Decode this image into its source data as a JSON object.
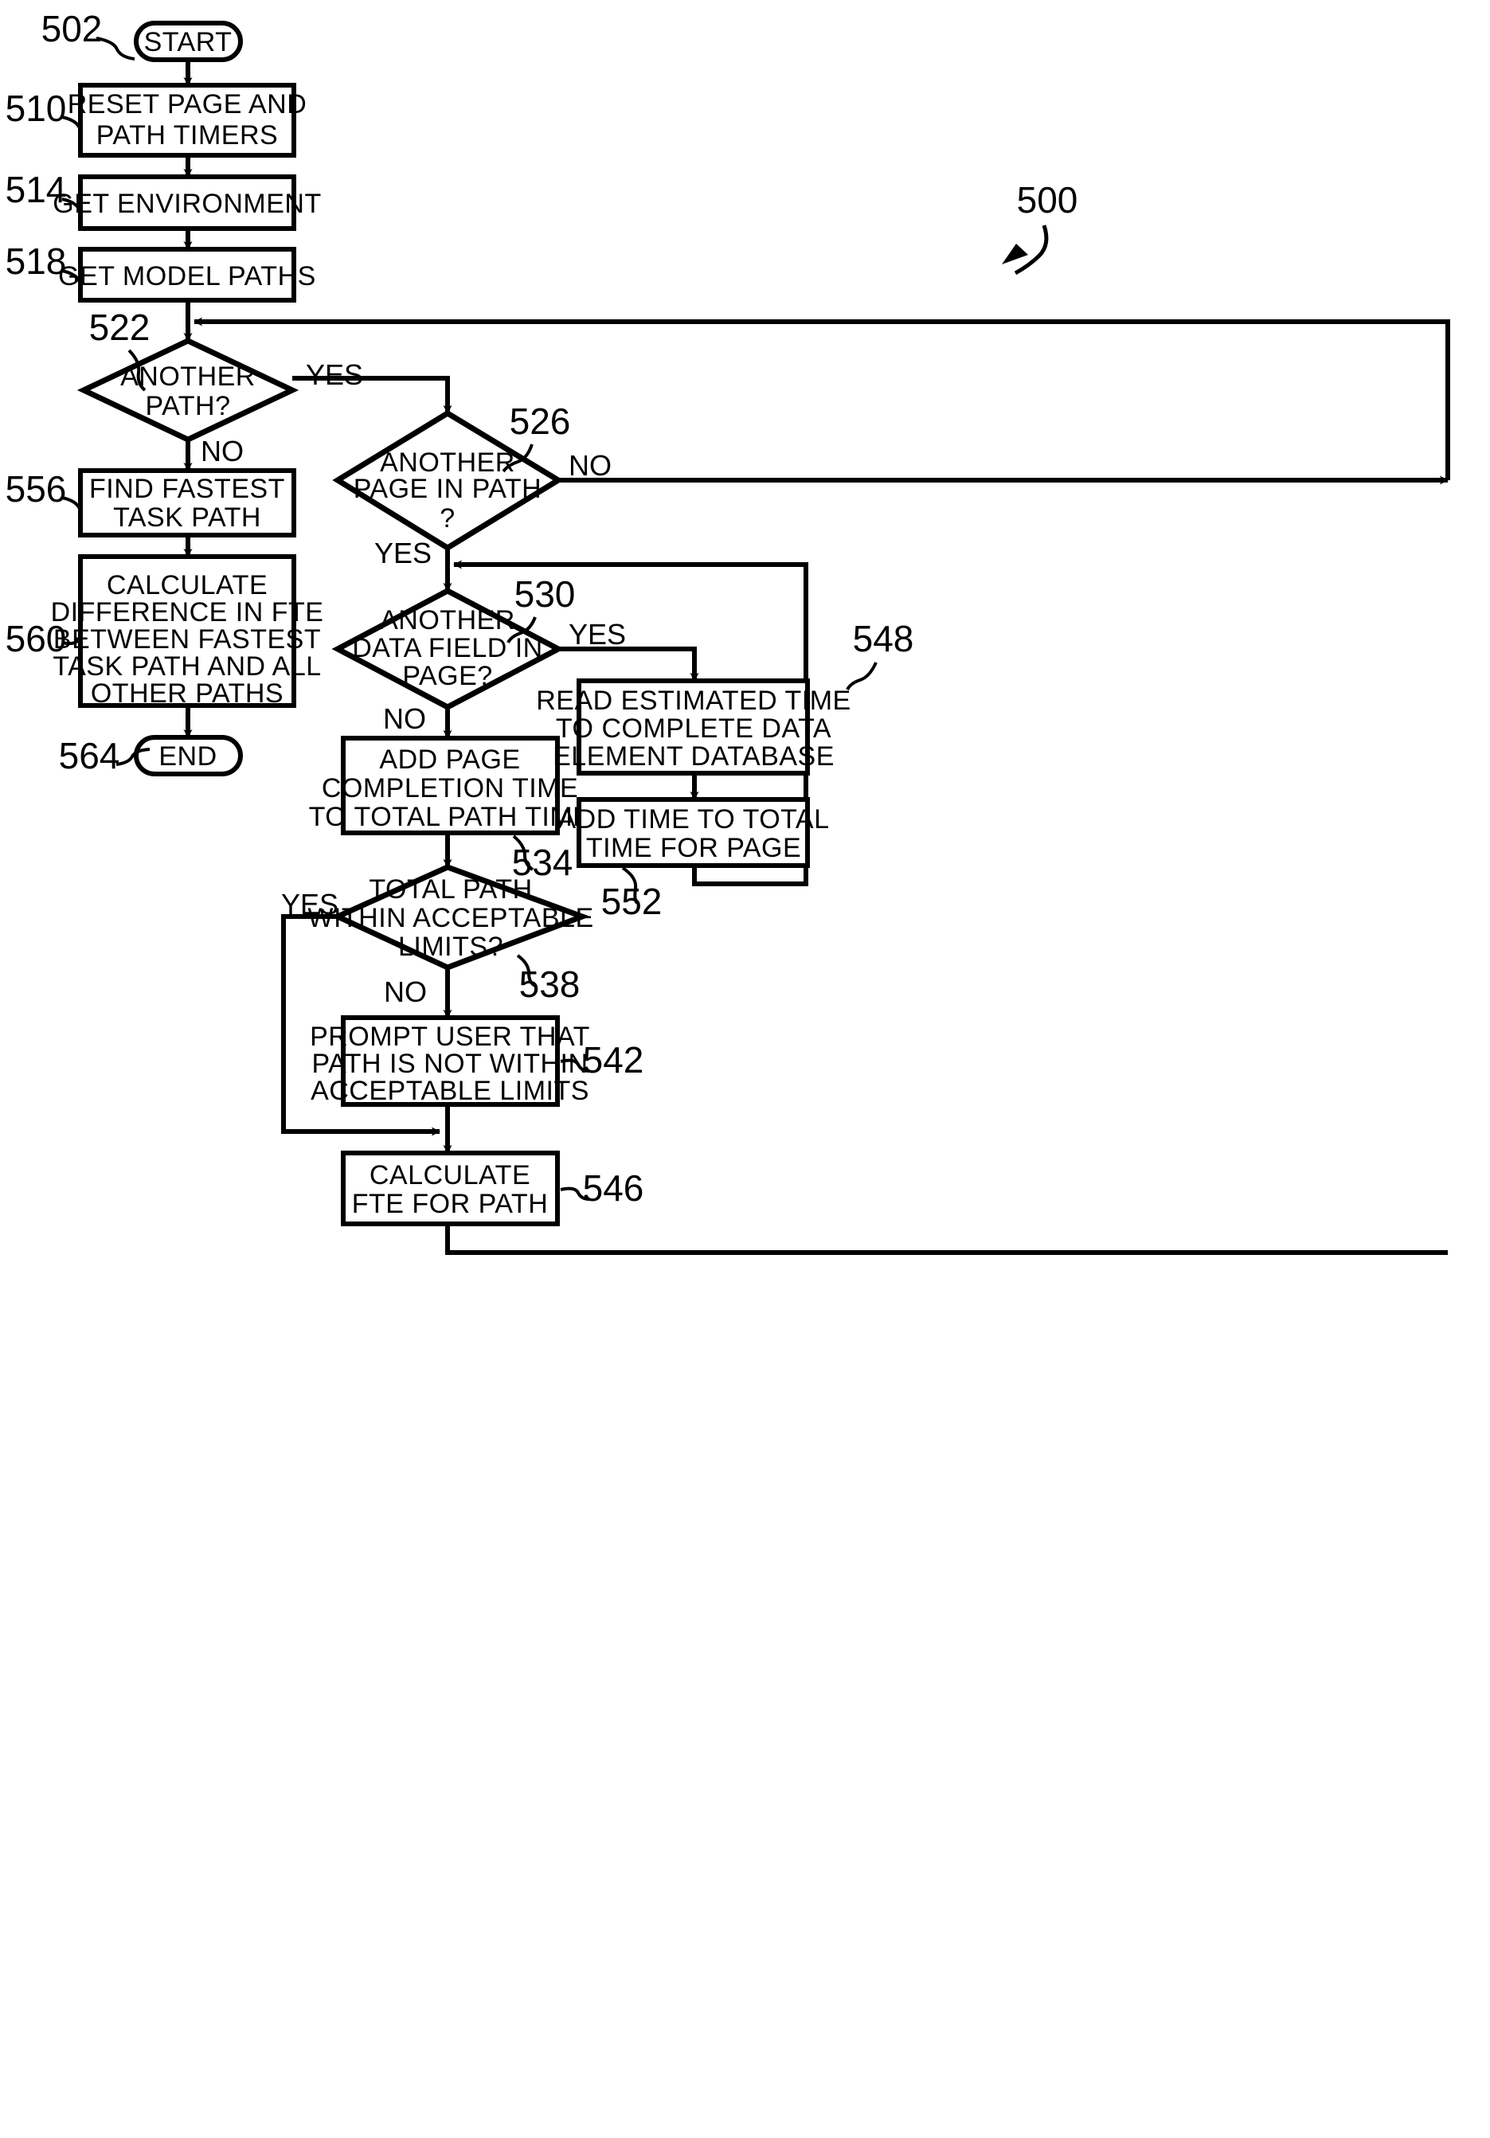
{
  "figure": {
    "ref_label": "500",
    "type": "process-flowchart"
  },
  "nodes": {
    "start": {
      "ref": "502",
      "shape": "terminator",
      "text": "START"
    },
    "reset": {
      "ref": "510",
      "shape": "process",
      "line1": "RESET PAGE AND",
      "line2": "PATH TIMERS"
    },
    "get_env": {
      "ref": "514",
      "shape": "process",
      "line1": "GET ENVIRONMENT"
    },
    "get_paths": {
      "ref": "518",
      "shape": "process",
      "line1": "GET MODEL PATHS"
    },
    "another_path": {
      "ref": "522",
      "shape": "decision",
      "line1": "ANOTHER",
      "line2": "PATH?"
    },
    "another_page": {
      "ref": "526",
      "shape": "decision",
      "line1": "ANOTHER",
      "line2": "PAGE IN PATH",
      "line3": "?"
    },
    "another_field": {
      "ref": "530",
      "shape": "decision",
      "line1": "ANOTHER",
      "line2": "DATA FIELD IN",
      "line3": "PAGE?"
    },
    "add_page_time": {
      "ref": "534",
      "shape": "process",
      "line1": "ADD PAGE",
      "line2": "COMPLETION TIME",
      "line3": "TO TOTAL PATH TIME"
    },
    "within_limits": {
      "ref": "538",
      "shape": "decision",
      "line1": "TOTAL PATH",
      "line2": "WITHIN ACCEPTABLE",
      "line3": "LIMITS?"
    },
    "prompt_user": {
      "ref": "542",
      "shape": "process",
      "line1": "PROMPT USER THAT",
      "line2": "PATH IS NOT WITHIN",
      "line3": "ACCEPTABLE LIMITS"
    },
    "calc_fte": {
      "ref": "546",
      "shape": "process",
      "line1": "CALCULATE",
      "line2": "FTE FOR PATH"
    },
    "read_est": {
      "ref": "548",
      "shape": "process",
      "line1": "READ ESTIMATED TIME",
      "line2": "TO COMPLETE DATA",
      "line3": "ELEMENT DATABASE"
    },
    "add_time": {
      "ref": "552",
      "shape": "process",
      "line1": "ADD TIME TO TOTAL",
      "line2": "TIME FOR PAGE"
    },
    "find_fastest": {
      "ref": "556",
      "shape": "process",
      "line1": "FIND FASTEST",
      "line2": "TASK PATH"
    },
    "calc_diff": {
      "ref": "560",
      "shape": "process",
      "line1": "CALCULATE",
      "line2": "DIFFERENCE IN FTE",
      "line3": "BETWEEN FASTEST",
      "line4": "TASK PATH AND ALL",
      "line5": "OTHER PATHS"
    },
    "end": {
      "ref": "564",
      "shape": "terminator",
      "text": "END"
    }
  },
  "edge_labels": {
    "path_yes": "YES",
    "path_no": "NO",
    "page_no": "NO",
    "page_yes": "YES",
    "field_yes": "YES",
    "field_no": "NO",
    "limits_yes": "YES",
    "limits_no": "NO"
  },
  "colors": {
    "stroke": "#000000",
    "fill": "#ffffff",
    "text": "#000000"
  }
}
